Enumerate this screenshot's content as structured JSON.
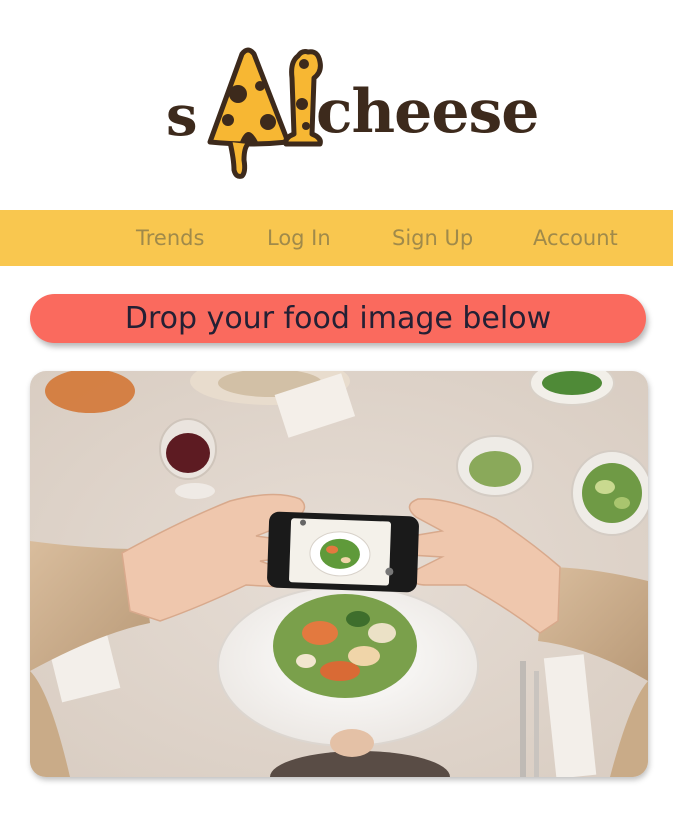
{
  "brand": {
    "logo_prefix": "s",
    "logo_word": "cheese",
    "logo_colors": {
      "cheese": "#f7b733",
      "outline": "#3d2a1c"
    }
  },
  "nav": {
    "background": "#f9c74f",
    "text_color": "#a08a4a",
    "items": [
      {
        "label": "Trends"
      },
      {
        "label": "Log In"
      },
      {
        "label": "Sign Up"
      },
      {
        "label": "Account"
      }
    ]
  },
  "upload": {
    "banner_text": "Drop your food image below",
    "banner_color": "#fa6a5e",
    "image_description_icon": "photo-food-smartphone"
  }
}
